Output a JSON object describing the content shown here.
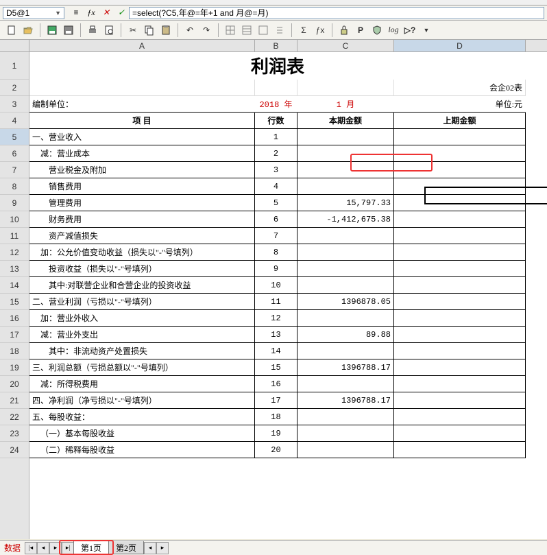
{
  "formula_bar": {
    "cell_ref": "D5@1",
    "formula": "=select(?C5,年@=年+1 and 月@=月)"
  },
  "columns": [
    "A",
    "B",
    "C",
    "D"
  ],
  "row_nums": [
    1,
    2,
    3,
    4,
    5,
    6,
    7,
    8,
    9,
    10,
    11,
    12,
    13,
    14,
    15,
    16,
    17,
    18,
    19,
    20,
    21,
    22,
    23,
    24
  ],
  "report": {
    "title": "利润表",
    "form_code": "会企02表",
    "unit_label": "编制单位：",
    "year": "2018 年",
    "month": "1 月",
    "currency_unit": "单位:元",
    "headers": {
      "item": "项    目",
      "line": "行数",
      "current": "本期金额",
      "prior": "上期金额"
    },
    "rows": [
      {
        "item": "一、营业收入",
        "line": "1",
        "current": "",
        "prior": ""
      },
      {
        "item": "    减：营业成本",
        "line": "2",
        "current": "",
        "prior": ""
      },
      {
        "item": "        营业税金及附加",
        "line": "3",
        "current": "",
        "prior": ""
      },
      {
        "item": "        销售费用",
        "line": "4",
        "current": "",
        "prior": ""
      },
      {
        "item": "        管理费用",
        "line": "5",
        "current": "15,797.33",
        "prior": ""
      },
      {
        "item": "        财务费用",
        "line": "6",
        "current": "-1,412,675.38",
        "prior": ""
      },
      {
        "item": "        资产减值损失",
        "line": "7",
        "current": "",
        "prior": ""
      },
      {
        "item": "    加：公允价值变动收益（损失以\"-\"号填列）",
        "line": "8",
        "current": "",
        "prior": ""
      },
      {
        "item": "        投资收益（损失以\"-\"号填列）",
        "line": "9",
        "current": "",
        "prior": ""
      },
      {
        "item": "        其中:对联营企业和合营企业的投资收益",
        "line": "10",
        "current": "",
        "prior": ""
      },
      {
        "item": "二、营业利润（亏损以\"-\"号填列）",
        "line": "11",
        "current": "1396878.05",
        "prior": ""
      },
      {
        "item": "    加：营业外收入",
        "line": "12",
        "current": "",
        "prior": ""
      },
      {
        "item": "    减：营业外支出",
        "line": "13",
        "current": "89.88",
        "prior": ""
      },
      {
        "item": "        其中：非流动资产处置损失",
        "line": "14",
        "current": "",
        "prior": ""
      },
      {
        "item": "三、利润总额（亏损总额以\"-\"号填列）",
        "line": "15",
        "current": "1396788.17",
        "prior": ""
      },
      {
        "item": "    减：所得税费用",
        "line": "16",
        "current": "",
        "prior": ""
      },
      {
        "item": "四、净利润（净亏损以\"-\"号填列）",
        "line": "17",
        "current": "1396788.17",
        "prior": ""
      },
      {
        "item": "五、每股收益：",
        "line": "18",
        "current": "",
        "prior": ""
      },
      {
        "item": "    （一）基本每股收益",
        "line": "19",
        "current": "",
        "prior": ""
      },
      {
        "item": "    （二）稀释每股收益",
        "line": "20",
        "current": "",
        "prior": ""
      }
    ]
  },
  "bottom": {
    "label": "数据",
    "tabs": [
      "第1页",
      "第2页"
    ]
  }
}
